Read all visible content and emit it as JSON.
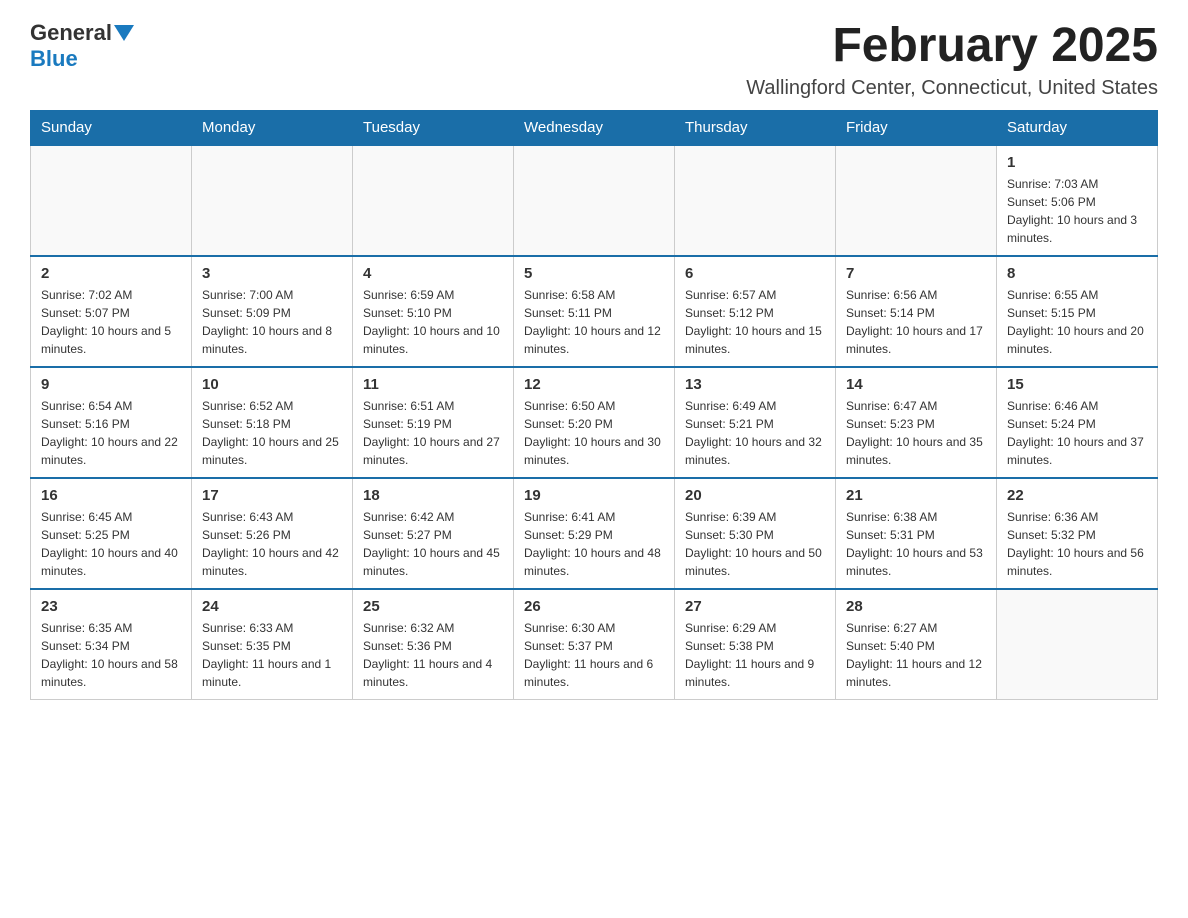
{
  "logo": {
    "general": "General",
    "blue": "Blue"
  },
  "title": "February 2025",
  "location": "Wallingford Center, Connecticut, United States",
  "weekdays": [
    "Sunday",
    "Monday",
    "Tuesday",
    "Wednesday",
    "Thursday",
    "Friday",
    "Saturday"
  ],
  "weeks": [
    [
      {
        "day": "",
        "info": ""
      },
      {
        "day": "",
        "info": ""
      },
      {
        "day": "",
        "info": ""
      },
      {
        "day": "",
        "info": ""
      },
      {
        "day": "",
        "info": ""
      },
      {
        "day": "",
        "info": ""
      },
      {
        "day": "1",
        "info": "Sunrise: 7:03 AM\nSunset: 5:06 PM\nDaylight: 10 hours and 3 minutes."
      }
    ],
    [
      {
        "day": "2",
        "info": "Sunrise: 7:02 AM\nSunset: 5:07 PM\nDaylight: 10 hours and 5 minutes."
      },
      {
        "day": "3",
        "info": "Sunrise: 7:00 AM\nSunset: 5:09 PM\nDaylight: 10 hours and 8 minutes."
      },
      {
        "day": "4",
        "info": "Sunrise: 6:59 AM\nSunset: 5:10 PM\nDaylight: 10 hours and 10 minutes."
      },
      {
        "day": "5",
        "info": "Sunrise: 6:58 AM\nSunset: 5:11 PM\nDaylight: 10 hours and 12 minutes."
      },
      {
        "day": "6",
        "info": "Sunrise: 6:57 AM\nSunset: 5:12 PM\nDaylight: 10 hours and 15 minutes."
      },
      {
        "day": "7",
        "info": "Sunrise: 6:56 AM\nSunset: 5:14 PM\nDaylight: 10 hours and 17 minutes."
      },
      {
        "day": "8",
        "info": "Sunrise: 6:55 AM\nSunset: 5:15 PM\nDaylight: 10 hours and 20 minutes."
      }
    ],
    [
      {
        "day": "9",
        "info": "Sunrise: 6:54 AM\nSunset: 5:16 PM\nDaylight: 10 hours and 22 minutes."
      },
      {
        "day": "10",
        "info": "Sunrise: 6:52 AM\nSunset: 5:18 PM\nDaylight: 10 hours and 25 minutes."
      },
      {
        "day": "11",
        "info": "Sunrise: 6:51 AM\nSunset: 5:19 PM\nDaylight: 10 hours and 27 minutes."
      },
      {
        "day": "12",
        "info": "Sunrise: 6:50 AM\nSunset: 5:20 PM\nDaylight: 10 hours and 30 minutes."
      },
      {
        "day": "13",
        "info": "Sunrise: 6:49 AM\nSunset: 5:21 PM\nDaylight: 10 hours and 32 minutes."
      },
      {
        "day": "14",
        "info": "Sunrise: 6:47 AM\nSunset: 5:23 PM\nDaylight: 10 hours and 35 minutes."
      },
      {
        "day": "15",
        "info": "Sunrise: 6:46 AM\nSunset: 5:24 PM\nDaylight: 10 hours and 37 minutes."
      }
    ],
    [
      {
        "day": "16",
        "info": "Sunrise: 6:45 AM\nSunset: 5:25 PM\nDaylight: 10 hours and 40 minutes."
      },
      {
        "day": "17",
        "info": "Sunrise: 6:43 AM\nSunset: 5:26 PM\nDaylight: 10 hours and 42 minutes."
      },
      {
        "day": "18",
        "info": "Sunrise: 6:42 AM\nSunset: 5:27 PM\nDaylight: 10 hours and 45 minutes."
      },
      {
        "day": "19",
        "info": "Sunrise: 6:41 AM\nSunset: 5:29 PM\nDaylight: 10 hours and 48 minutes."
      },
      {
        "day": "20",
        "info": "Sunrise: 6:39 AM\nSunset: 5:30 PM\nDaylight: 10 hours and 50 minutes."
      },
      {
        "day": "21",
        "info": "Sunrise: 6:38 AM\nSunset: 5:31 PM\nDaylight: 10 hours and 53 minutes."
      },
      {
        "day": "22",
        "info": "Sunrise: 6:36 AM\nSunset: 5:32 PM\nDaylight: 10 hours and 56 minutes."
      }
    ],
    [
      {
        "day": "23",
        "info": "Sunrise: 6:35 AM\nSunset: 5:34 PM\nDaylight: 10 hours and 58 minutes."
      },
      {
        "day": "24",
        "info": "Sunrise: 6:33 AM\nSunset: 5:35 PM\nDaylight: 11 hours and 1 minute."
      },
      {
        "day": "25",
        "info": "Sunrise: 6:32 AM\nSunset: 5:36 PM\nDaylight: 11 hours and 4 minutes."
      },
      {
        "day": "26",
        "info": "Sunrise: 6:30 AM\nSunset: 5:37 PM\nDaylight: 11 hours and 6 minutes."
      },
      {
        "day": "27",
        "info": "Sunrise: 6:29 AM\nSunset: 5:38 PM\nDaylight: 11 hours and 9 minutes."
      },
      {
        "day": "28",
        "info": "Sunrise: 6:27 AM\nSunset: 5:40 PM\nDaylight: 11 hours and 12 minutes."
      },
      {
        "day": "",
        "info": ""
      }
    ]
  ]
}
